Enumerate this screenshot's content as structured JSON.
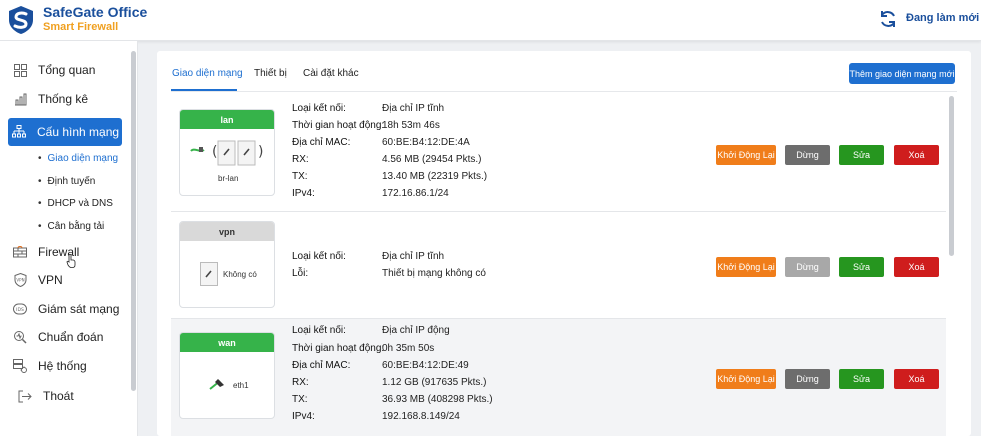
{
  "brand": {
    "name": "SafeGate Office",
    "subtitle": "Smart Firewall"
  },
  "header": {
    "refresh_label": "Đang làm mới",
    "refresh_icon": "refresh-icon"
  },
  "colors": {
    "primary": "#1e6fd0",
    "brand_orange": "#f0a020",
    "restart": "#f07d1a",
    "stop": "#6d6d6d",
    "edit": "#26961f",
    "delete": "#cf1d1d",
    "iface_up": "#36b34a"
  },
  "sidebar": {
    "items": [
      {
        "label": "Tổng quan",
        "icon": "dashboard-icon"
      },
      {
        "label": "Thống kê",
        "icon": "bar-chart-icon"
      },
      {
        "label": "Cấu hình mạng",
        "icon": "network-icon"
      },
      {
        "label": "Firewall",
        "icon": "firewall-icon"
      },
      {
        "label": "VPN",
        "icon": "vpn-shield-icon"
      },
      {
        "label": "Giám sát mạng",
        "icon": "ids-icon"
      },
      {
        "label": "Chuẩn đoán",
        "icon": "diagnostic-icon"
      },
      {
        "label": "Hệ thống",
        "icon": "system-icon"
      },
      {
        "label": "Thoát",
        "icon": "logout-icon"
      }
    ],
    "subitems": [
      "Giao diện mạng",
      "Định tuyến",
      "DHCP và DNS",
      "Cân bằng tải"
    ]
  },
  "tabs": [
    "Giao diện mạng",
    "Thiết bị",
    "Cài đặt khác"
  ],
  "add_button": "Thêm giao diện mạng mới",
  "row_buttons": {
    "restart": "Khởi Động Lại",
    "stop": "Dừng",
    "edit": "Sửa",
    "delete": "Xoá"
  },
  "interfaces": [
    {
      "name": "lan",
      "device": "br-lan",
      "fields": [
        {
          "key": "Loại kết nối:",
          "value": "Địa chỉ IP tĩnh"
        },
        {
          "key": "Thời gian hoạt động:",
          "value": "18h 53m 46s"
        },
        {
          "key": "Địa chỉ MAC:",
          "value": "60:BE:B4:12:DE:4A"
        },
        {
          "key": "RX:",
          "value": "4.56 MB (29454 Pkts.)"
        },
        {
          "key": "TX:",
          "value": "13.40 MB (22319 Pkts.)"
        },
        {
          "key": "IPv4:",
          "value": "172.16.86.1/24"
        }
      ]
    },
    {
      "name": "vpn",
      "device": "Không có",
      "fields": [
        {
          "key": "Loại kết nối:",
          "value": "Địa chỉ IP tĩnh"
        },
        {
          "key": "Lỗi:",
          "value": "Thiết bị mạng không có"
        }
      ]
    },
    {
      "name": "wan",
      "device": "eth1",
      "fields": [
        {
          "key": "Loại kết nối:",
          "value": "Địa chỉ IP động"
        },
        {
          "key": "Thời gian hoạt động:",
          "value": "0h 35m 50s"
        },
        {
          "key": "Địa chỉ MAC:",
          "value": "60:BE:B4:12:DE:49"
        },
        {
          "key": "RX:",
          "value": "1.12 GB (917635 Pkts.)"
        },
        {
          "key": "TX:",
          "value": "36.93 MB (408298 Pkts.)"
        },
        {
          "key": "IPv4:",
          "value": "192.168.8.149/24"
        }
      ]
    }
  ]
}
